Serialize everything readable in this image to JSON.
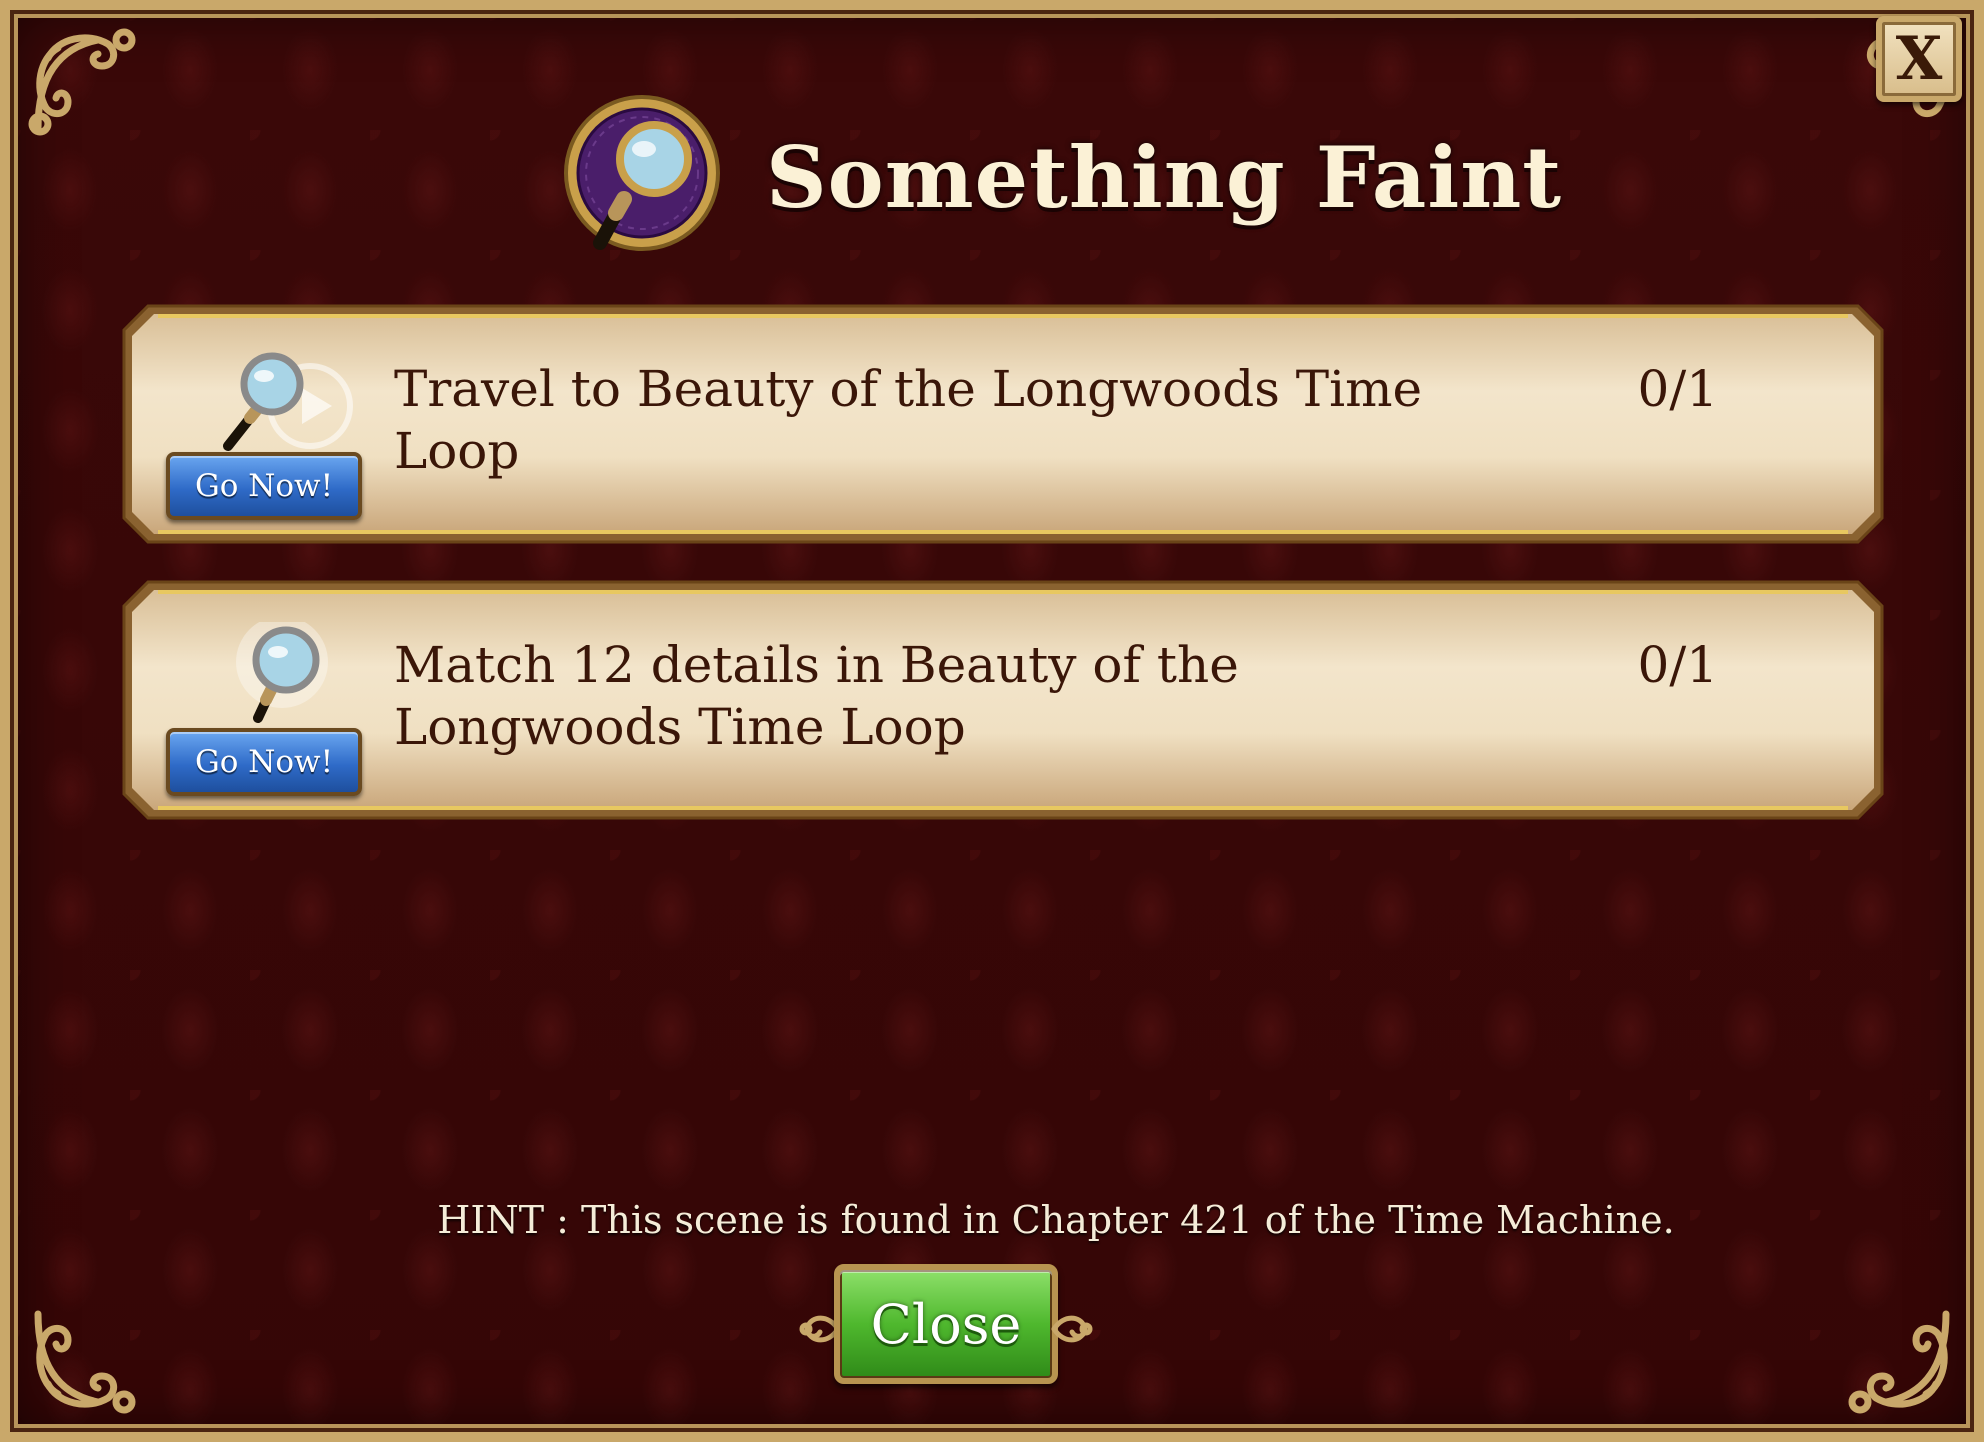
{
  "dialog": {
    "title": "Something Faint",
    "close_x_label": "X",
    "header_icon": "magnifying-glass-icon"
  },
  "tasks": [
    {
      "text": "Travel to Beauty of the Longwoods Time Loop",
      "progress": "0/1",
      "button_label": "Go Now!",
      "icon": "magnifying-glass-play-icon"
    },
    {
      "text": "Match 12 details in Beauty of the Longwoods Time Loop",
      "progress": "0/1",
      "button_label": "Go Now!",
      "icon": "magnifying-glass-sparkle-icon"
    }
  ],
  "hint": "HINT : This scene is found in Chapter 421 of the Time Machine.",
  "footer": {
    "close_label": "Close"
  },
  "colors": {
    "background": "#3d0a0a",
    "gold_border": "#c9a86a",
    "panel": "#ecd9b8",
    "title_text": "#fbf1d6",
    "task_text": "#3a1608",
    "go_button": "#2f6bc8",
    "close_button": "#4fb82e"
  }
}
